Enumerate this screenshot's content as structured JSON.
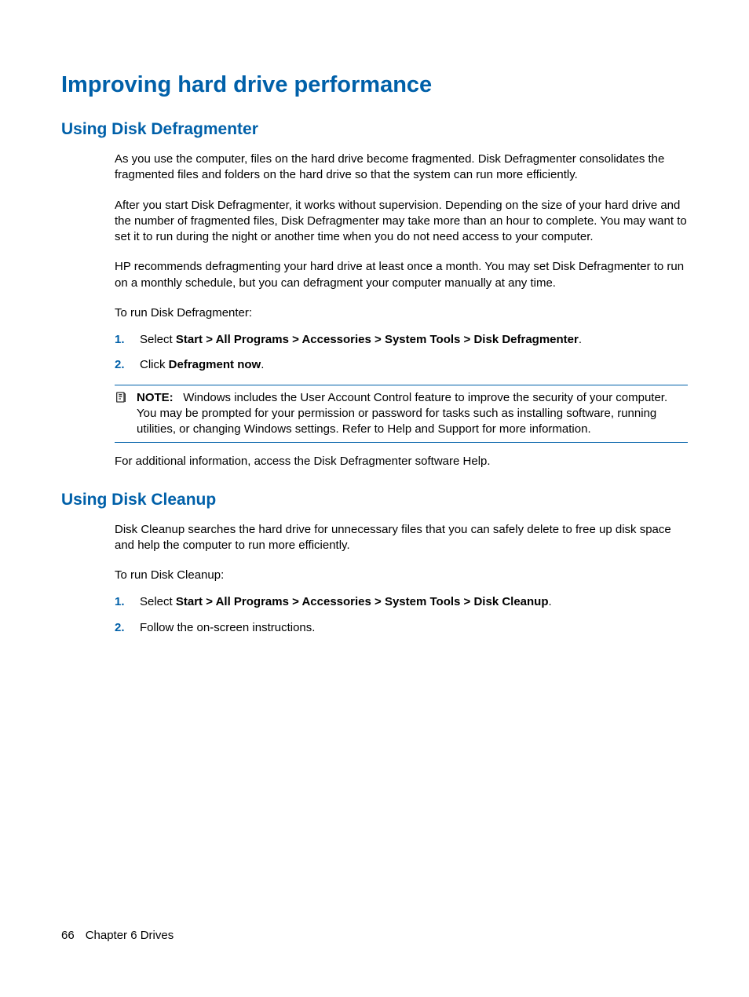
{
  "title": "Improving hard drive performance",
  "section1": {
    "heading": "Using Disk Defragmenter",
    "para1": "As you use the computer, files on the hard drive become fragmented. Disk Defragmenter consolidates the fragmented files and folders on the hard drive so that the system can run more efficiently.",
    "para2": "After you start Disk Defragmenter, it works without supervision. Depending on the size of your hard drive and the number of fragmented files, Disk Defragmenter may take more than an hour to complete. You may want to set it to run during the night or another time when you do not need access to your computer.",
    "para3": "HP recommends defragmenting your hard drive at least once a month. You may set Disk Defragmenter to run on a monthly schedule, but you can defragment your computer manually at any time.",
    "para4": "To run Disk Defragmenter:",
    "step1_num": "1.",
    "step1_prefix": "Select ",
    "step1_bold": "Start > All Programs > Accessories > System Tools > Disk Defragmenter",
    "step1_suffix": ".",
    "step2_num": "2.",
    "step2_prefix": "Click ",
    "step2_bold": "Defragment now",
    "step2_suffix": ".",
    "note_label": "NOTE:",
    "note_text": "Windows includes the User Account Control feature to improve the security of your computer. You may be prompted for your permission or password for tasks such as installing software, running utilities, or changing Windows settings. Refer to Help and Support for more information.",
    "para5": "For additional information, access the Disk Defragmenter software Help."
  },
  "section2": {
    "heading": "Using Disk Cleanup",
    "para1": "Disk Cleanup searches the hard drive for unnecessary files that you can safely delete to free up disk space and help the computer to run more efficiently.",
    "para2": "To run Disk Cleanup:",
    "step1_num": "1.",
    "step1_prefix": "Select ",
    "step1_bold": "Start > All Programs > Accessories > System Tools > Disk Cleanup",
    "step1_suffix": ".",
    "step2_num": "2.",
    "step2_text": "Follow the on-screen instructions."
  },
  "footer": {
    "page_number": "66",
    "chapter": "Chapter 6   Drives"
  }
}
